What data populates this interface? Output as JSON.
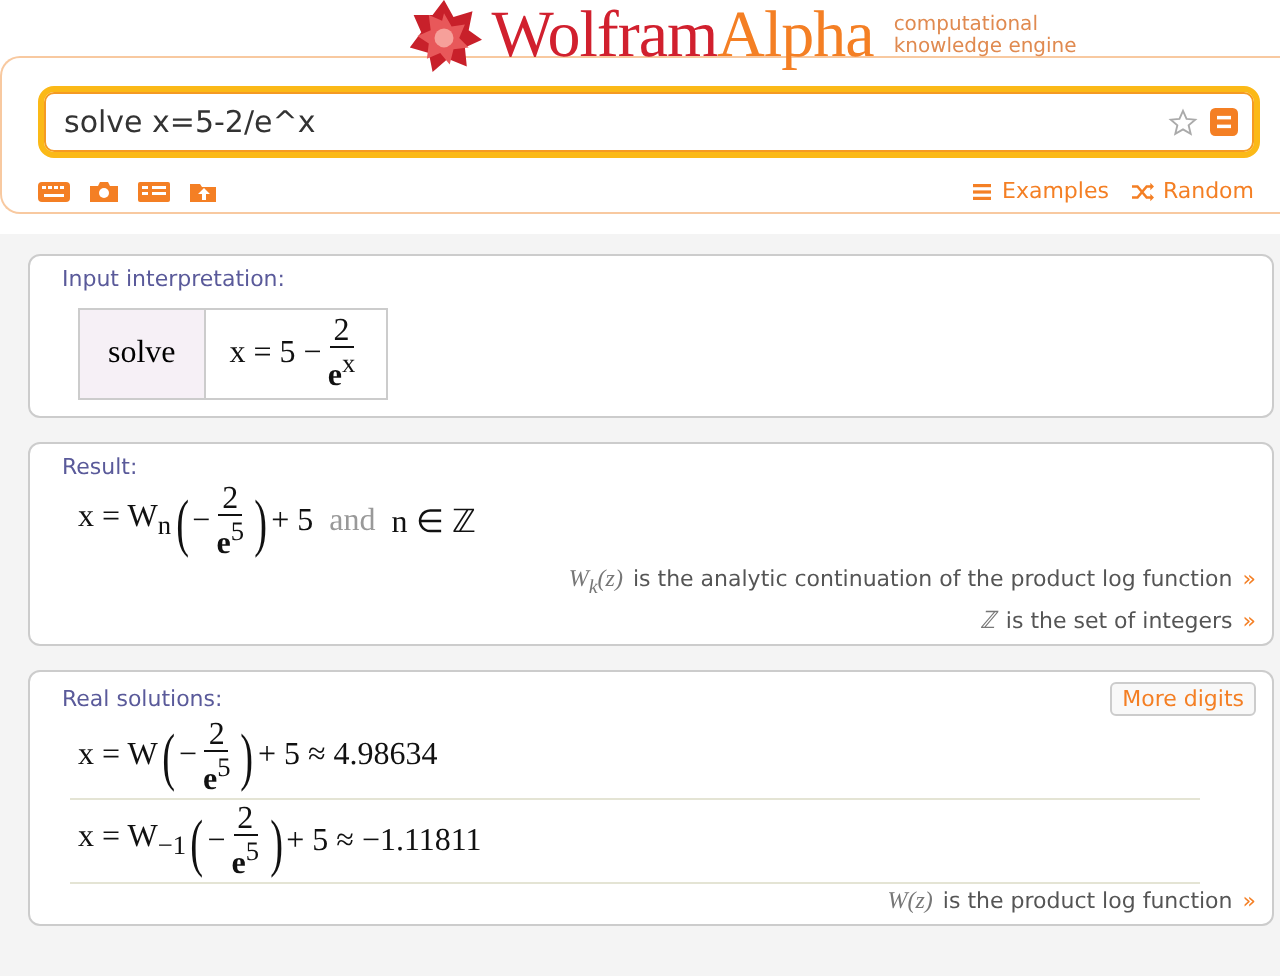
{
  "logo": {
    "name": "Wolfram",
    "accent": "Alpha",
    "tagline": [
      "computational",
      "knowledge engine"
    ]
  },
  "search": {
    "value": "solve x=5-2/e^x"
  },
  "links": [
    {
      "label": "Examples"
    },
    {
      "label": "Random"
    }
  ],
  "pods": [
    {
      "title": "Input interpretation:",
      "kind": "table",
      "cells": [
        {
          "kind": "word",
          "text": "solve"
        },
        {
          "kind": "formula",
          "tokens": [
            {
              "kind": "t",
              "text": "x = 5 − "
            },
            {
              "kind": "frac",
              "num": "2",
              "den": "**e**$^{x}$"
            }
          ]
        }
      ]
    },
    {
      "title": "Result:",
      "kind": "formulas",
      "formulas": [
        [
          {
            "kind": "t",
            "text": "x = W$_{n}$"
          },
          {
            "kind": "paren",
            "text": "("
          },
          {
            "kind": "t",
            "text": "− "
          },
          {
            "kind": "frac",
            "num": "2",
            "den": "**e**$^{5}$"
          },
          {
            "kind": "paren",
            "text": ")"
          },
          {
            "kind": "t",
            "text": "+ 5"
          },
          {
            "kind": "word",
            "text": "and"
          },
          {
            "kind": "t",
            "text": "n ∈ ℤ"
          }
        ]
      ],
      "notes": [
        {
          "symbol": "W$_{k}$(z)",
          "text": "is the analytic continuation of the product log function",
          "link": "»"
        },
        {
          "symbol": "ℤ",
          "text": "is the set of integers",
          "link": "»"
        }
      ]
    },
    {
      "title": "Real solutions:",
      "kind": "formulas",
      "button": "More digits",
      "formulas": [
        [
          {
            "kind": "t",
            "text": "x = W"
          },
          {
            "kind": "paren",
            "text": "("
          },
          {
            "kind": "t",
            "text": "− "
          },
          {
            "kind": "frac",
            "num": "2",
            "den": "**e**$^{5}$"
          },
          {
            "kind": "paren",
            "text": ")"
          },
          {
            "kind": "t",
            "text": "+ 5 ≈ 4.98634"
          }
        ],
        [
          {
            "kind": "t",
            "text": "x = W$_{−1}$"
          },
          {
            "kind": "paren",
            "text": "("
          },
          {
            "kind": "t",
            "text": "− "
          },
          {
            "kind": "frac",
            "num": "2",
            "den": "**e**$^{5}$"
          },
          {
            "kind": "paren",
            "text": ")"
          },
          {
            "kind": "t",
            "text": "+ 5 ≈ −1.11811"
          }
        ]
      ],
      "notes": [
        {
          "symbol": "W(z)",
          "text": "is the product log function",
          "link": "»"
        }
      ]
    }
  ]
}
